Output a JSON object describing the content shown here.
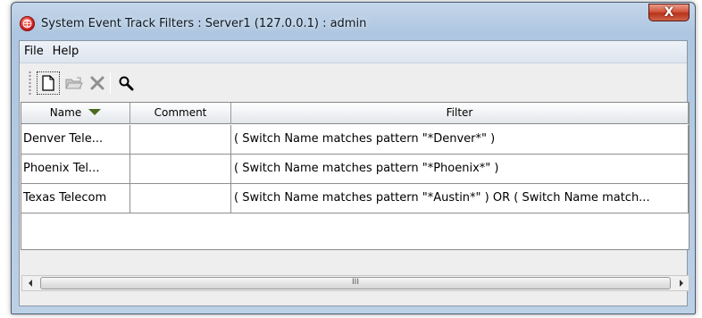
{
  "window": {
    "title": "System Event Track Filters : Server1 (127.0.0.1) : admin",
    "close_label": "X"
  },
  "menu": [
    {
      "label": "File"
    },
    {
      "label": "Help"
    }
  ],
  "toolbar": {
    "buttons": [
      {
        "name": "new",
        "icon": "new-document-icon"
      },
      {
        "name": "open",
        "icon": "open-folder-icon"
      },
      {
        "name": "delete",
        "icon": "delete-x-icon"
      },
      {
        "name": "find",
        "icon": "magnifier-icon"
      }
    ]
  },
  "table": {
    "columns": [
      "Name",
      "Comment",
      "Filter"
    ],
    "sort_column": "Name",
    "rows": [
      {
        "name": "Denver Tele...",
        "comment": "",
        "filter": "( Switch Name matches pattern \"*Denver*\" )"
      },
      {
        "name": "Phoenix Tel...",
        "comment": "",
        "filter": "( Switch Name matches pattern \"*Phoenix*\" )"
      },
      {
        "name": "Texas Telecom",
        "comment": "",
        "filter": "( Switch Name matches pattern \"*Austin*\" ) OR ( Switch Name match..."
      }
    ]
  },
  "scrollbar": {
    "thumb_grip": "III"
  }
}
